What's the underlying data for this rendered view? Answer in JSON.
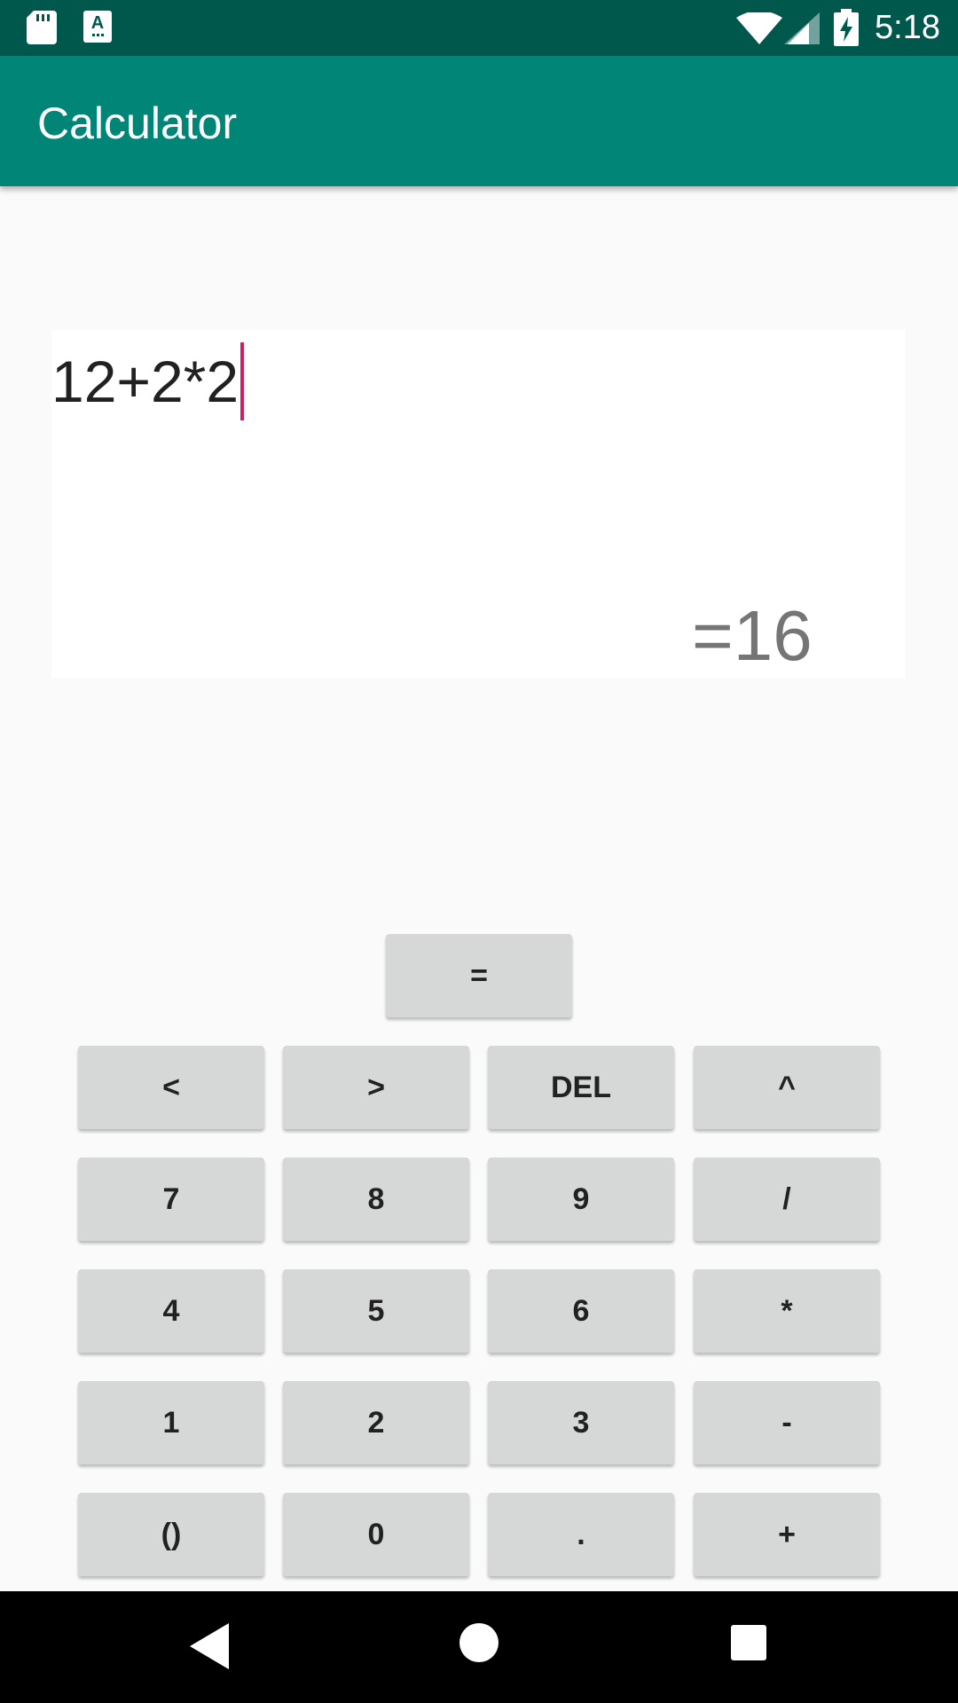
{
  "status_bar": {
    "time": "5:18",
    "icons": [
      "sd-card-icon",
      "a-keyboard-icon",
      "wifi-icon",
      "signal-icon",
      "battery-charging-icon"
    ]
  },
  "app_bar": {
    "title": "Calculator"
  },
  "display": {
    "expression": "12+2*2",
    "result": "=16"
  },
  "keypad": {
    "equals": "=",
    "rows": [
      [
        "<",
        ">",
        "DEL",
        "^"
      ],
      [
        "7",
        "8",
        "9",
        "/"
      ],
      [
        "4",
        "5",
        "6",
        "*"
      ],
      [
        "1",
        "2",
        "3",
        "-"
      ],
      [
        "()",
        "0",
        ".",
        "+"
      ]
    ]
  },
  "nav_bar": {
    "icons": [
      "back-icon",
      "home-icon",
      "recents-icon"
    ]
  },
  "colors": {
    "status_bar": "#00574b",
    "app_bar": "#008577",
    "accent_caret": "#d81b60",
    "button_bg": "#d6d7d7",
    "background": "#fafafa"
  }
}
